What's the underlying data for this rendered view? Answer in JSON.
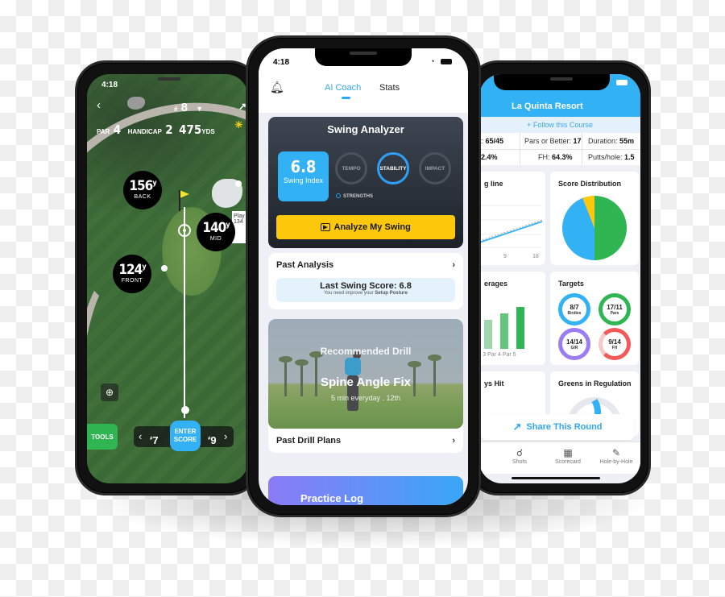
{
  "left_phone": {
    "status_time": "4:18",
    "hole_prefix": "#",
    "hole_number": "8",
    "par_label": "PAR",
    "par_value": "4",
    "handicap_label": "HANDICAP",
    "handicap_value": "2",
    "distance_value": "475",
    "distance_unit": "YDS",
    "yardages": [
      {
        "value": "156",
        "unit": "y",
        "label": "BACK"
      },
      {
        "value": "140",
        "unit": "y",
        "label": "MID"
      },
      {
        "value": "124",
        "unit": "y",
        "label": "FRONT"
      }
    ],
    "player_card_text": "Play 134",
    "tools_label": "TOOLS",
    "prev_hole": "7",
    "next_hole": "9",
    "enter_score_label": "ENTER SCORE"
  },
  "center_phone": {
    "status_time": "4:18",
    "tabs": [
      {
        "label": "AI Coach",
        "active": true
      },
      {
        "label": "Stats",
        "active": false
      }
    ],
    "swing_analyzer": {
      "title": "Swing Analyzer",
      "swing_index_value": "6.8",
      "swing_index_label": "Swing Index",
      "metrics": [
        {
          "label": "TEMPO",
          "active": false
        },
        {
          "label": "STABILITY",
          "active": true
        },
        {
          "label": "IMPACT",
          "active": false
        }
      ],
      "legend": "STRENGTHS",
      "analyze_button": "Analyze My Swing"
    },
    "past_analysis": {
      "title": "Past Analysis",
      "last_score": "Last Swing Score: 6.8",
      "hint_prefix": "You need improve your",
      "hint_emphasis": "Setup Posture"
    },
    "drill": {
      "label": "Recommended Drill",
      "name": "Spine Angle Fix",
      "meta": "5 min everyday . 12th",
      "past_plans": "Past Drill Plans"
    },
    "practice_log": "Practice Log",
    "colors": {
      "accent": "#2fa8f3",
      "analyze": "#fdc80b",
      "swing_index": "#33b1f5"
    }
  },
  "right_phone": {
    "course_name": "La Quinta Resort",
    "follow_label": "+ Follow this Course",
    "stats": [
      {
        "label": "t:",
        "value": "65/45"
      },
      {
        "label": "Pars or Better:",
        "value": "17"
      },
      {
        "label": "Duration:",
        "value": "55m"
      },
      {
        "label": "",
        "value": "2.4%"
      },
      {
        "label": "FH:",
        "value": "64.3%"
      },
      {
        "label": "Putts/hole:",
        "value": "1.5"
      }
    ],
    "tiles": {
      "handicap_line": "g line",
      "handicap_ticks": [
        "9",
        "18"
      ],
      "score_distribution": "Score Distribution",
      "averages": "erages",
      "averages_ticks": [
        "r 3",
        "Par 4",
        "Par 5"
      ],
      "targets": "Targets",
      "fairways": "ys Hit",
      "gir": "Greens in Regulation"
    },
    "targets": [
      {
        "value": "8/7",
        "label": "Birdies",
        "color": "#33b1f5"
      },
      {
        "value": "17/11",
        "label": "Pars",
        "color": "#2fb552"
      },
      {
        "value": "14/14",
        "label": "GIR",
        "color": "#9b7cf3"
      },
      {
        "value": "9/14",
        "label": "FH",
        "color": "#f25a5a"
      }
    ],
    "score_distribution": [
      {
        "name": "green",
        "share": 0.5,
        "color": "#2fb552"
      },
      {
        "name": "blue",
        "share": 0.44,
        "color": "#33b1f5"
      },
      {
        "name": "yellow",
        "share": 0.06,
        "color": "#fdc80b"
      }
    ],
    "gir_fraction": 0.5,
    "share_label": "Share This Round",
    "tabbar": [
      {
        "label": "Shots",
        "icon": "shots-icon"
      },
      {
        "label": "Scorecard",
        "icon": "scorecard-icon"
      },
      {
        "label": "Hole-by-Hole",
        "icon": "pencil-icon"
      }
    ]
  }
}
